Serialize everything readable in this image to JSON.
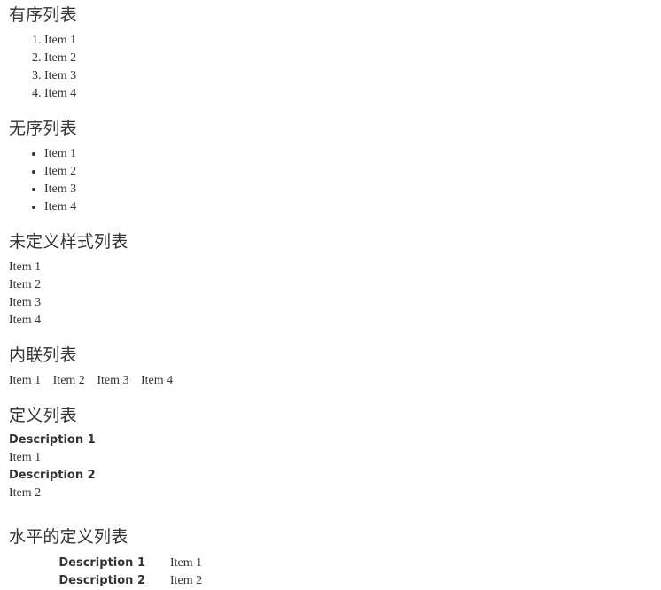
{
  "page": {
    "background_color": "#ffffff",
    "text_color": "#333333"
  },
  "sections": [
    {
      "id": "ordered-list",
      "heading": "有序列表",
      "list_type": "ordered",
      "items": [
        "Item 1",
        "Item 2",
        "Item 3",
        "Item 4"
      ]
    },
    {
      "id": "unordered-list",
      "heading": "无序列表",
      "list_type": "unordered",
      "items": [
        "Item 1",
        "Item 2",
        "Item 3",
        "Item 4"
      ]
    },
    {
      "id": "unstyled-list",
      "heading": "未定义样式列表",
      "list_type": "unstyled",
      "items": [
        "Item 1",
        "Item 2",
        "Item 3",
        "Item 4"
      ]
    },
    {
      "id": "inline-list",
      "heading": "内联列表",
      "list_type": "inline",
      "items": [
        "Item 1",
        "Item 2",
        "Item 3",
        "Item 4"
      ]
    },
    {
      "id": "definition-list",
      "heading": "定义列表",
      "list_type": "definition",
      "pairs": [
        {
          "term": "Description 1",
          "description": "Item 1"
        },
        {
          "term": "Description 2",
          "description": "Item 2"
        }
      ]
    },
    {
      "id": "horizontal-definition-list",
      "heading": "水平的定义列表",
      "list_type": "definition-horizontal",
      "pairs": [
        {
          "term": "Description 1",
          "description": "Item 1"
        },
        {
          "term": "Description 2",
          "description": "Item 2"
        }
      ]
    }
  ]
}
